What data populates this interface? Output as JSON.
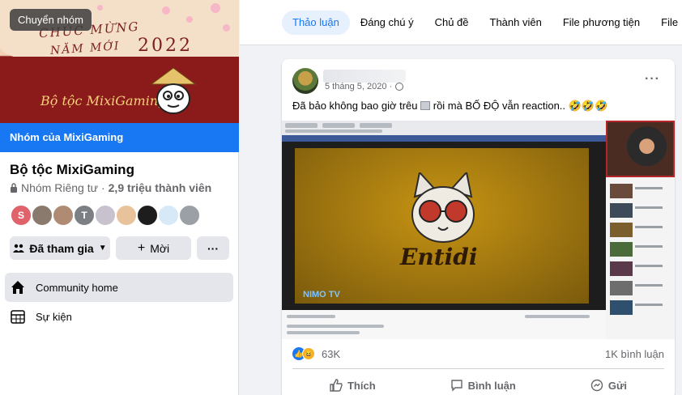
{
  "cover": {
    "switch_button": "Chuyển nhóm",
    "greeting_line1": "CHÚC MỪNG",
    "greeting_line2": "NĂM MỚI",
    "year": "2022",
    "brand": "Bộ tộc MixiGaming"
  },
  "group": {
    "banner": "Nhóm của MixiGaming",
    "title": "Bộ tộc MixiGaming",
    "privacy": "Nhóm Riêng tư",
    "members": "2,9 triệu thành viên",
    "member_avatars": [
      {
        "initial": "S",
        "color": "#e0626a"
      },
      {
        "initial": "",
        "color": "#8a7a6e"
      },
      {
        "initial": "",
        "color": "#b08b73"
      },
      {
        "initial": "T",
        "color": "#7c7f84"
      },
      {
        "initial": "",
        "color": "#c8c2cf"
      },
      {
        "initial": "",
        "color": "#e8c29a"
      },
      {
        "initial": "",
        "color": "#1d1d1d"
      },
      {
        "initial": "",
        "color": "#d7e8f7"
      },
      {
        "initial": "",
        "color": "#9aa0a6"
      }
    ],
    "joined_button": "Đã tham gia",
    "new_button": "Mời",
    "more_button": "···"
  },
  "nav": {
    "community_home": "Community home",
    "events": "Sự kiện"
  },
  "tabs": [
    "Thảo luận",
    "Đáng chú ý",
    "Chủ đề",
    "Thành viên",
    "File phương tiện",
    "File"
  ],
  "post": {
    "date": "5 tháng 5, 2020 ·",
    "text_part1": "Đã bảo không bao giờ trêu ",
    "text_part2": " rồi mà BỐ ĐỘ vẫn reaction.. 🤣🤣🤣",
    "media": {
      "overlay_title": "Entidi",
      "logo": "NIMO TV"
    },
    "reaction_count": "63K",
    "comments": "1K bình luận",
    "actions": {
      "like": "Thích",
      "comment": "Bình luận",
      "share": "Gửi"
    }
  },
  "colors": {
    "accent": "#1877f2",
    "banner_bg": "#1877f2",
    "tab_active_bg": "#e7f0fd"
  }
}
